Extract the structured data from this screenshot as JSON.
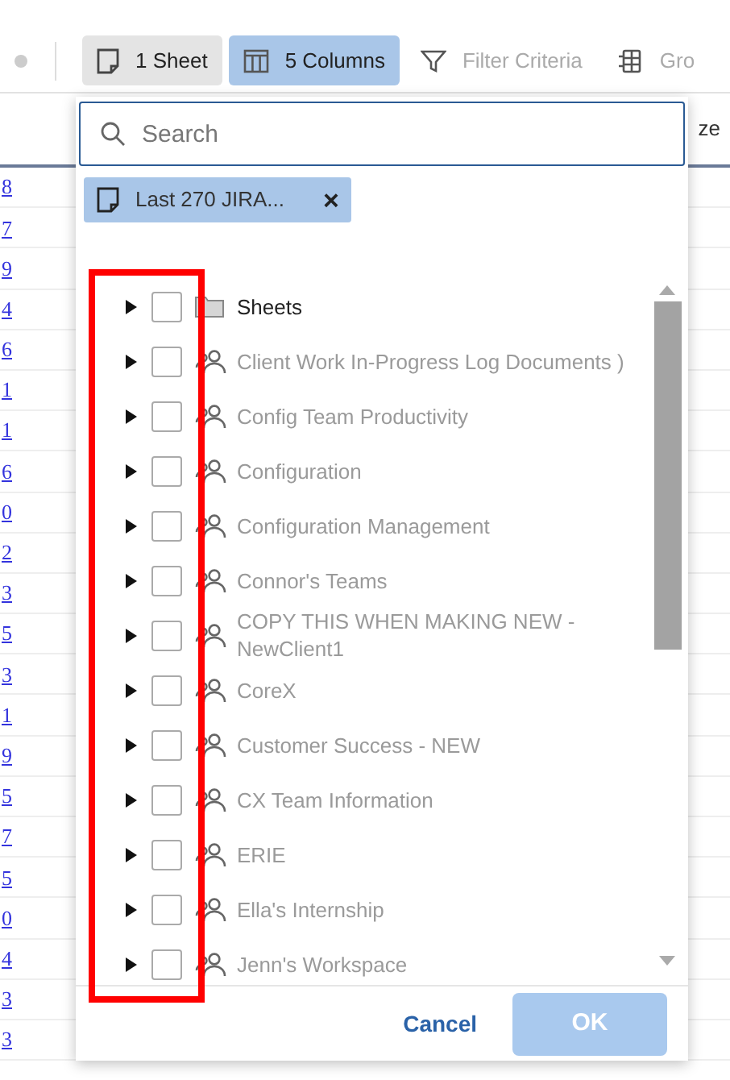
{
  "toolbar": {
    "buttons": [
      {
        "kind": "sheet",
        "label": "1 Sheet",
        "selected": false
      },
      {
        "kind": "columns",
        "label": "5 Columns",
        "selected": true
      },
      {
        "kind": "filter",
        "label": "Filter Criteria",
        "selected": false
      },
      {
        "kind": "group",
        "label": "Gro",
        "selected": false
      }
    ]
  },
  "table": {
    "header": {
      "column_2": "ze"
    },
    "rows": [
      "8",
      "7",
      "9",
      "4",
      "6",
      "1",
      "1",
      "6",
      "0",
      "2",
      "3",
      "5",
      "3",
      "1",
      "9",
      "5",
      "7",
      "5",
      "0",
      "4",
      "3",
      "3"
    ]
  },
  "popup": {
    "search": {
      "placeholder": "Search"
    },
    "chips": [
      {
        "label": "Last 270 JIRA...",
        "remove": "×"
      }
    ],
    "tree": [
      {
        "kind": "folder",
        "label": "Sheets",
        "checked": false,
        "expanded": false
      },
      {
        "kind": "workspace",
        "label": "Client Work In-Progress Log Documents )",
        "checked": false,
        "expanded": false
      },
      {
        "kind": "workspace",
        "label": "Config Team Productivity",
        "checked": false,
        "expanded": false
      },
      {
        "kind": "workspace",
        "label": "Configuration",
        "checked": false,
        "expanded": false
      },
      {
        "kind": "workspace",
        "label": "Configuration Management",
        "checked": false,
        "expanded": false
      },
      {
        "kind": "workspace",
        "label": "Connor's Teams",
        "checked": false,
        "expanded": false
      },
      {
        "kind": "workspace",
        "label": "COPY THIS WHEN MAKING NEW - NewClient1",
        "checked": false,
        "expanded": false
      },
      {
        "kind": "workspace",
        "label": "CoreX",
        "checked": false,
        "expanded": false
      },
      {
        "kind": "workspace",
        "label": "Customer Success - NEW",
        "checked": false,
        "expanded": false
      },
      {
        "kind": "workspace",
        "label": "CX Team Information",
        "checked": false,
        "expanded": false
      },
      {
        "kind": "workspace",
        "label": "ERIE",
        "checked": false,
        "expanded": false
      },
      {
        "kind": "workspace",
        "label": "Ella's Internship",
        "checked": false,
        "expanded": false
      },
      {
        "kind": "workspace",
        "label": "Jenn's Workspace",
        "checked": false,
        "expanded": false
      }
    ],
    "buttons": [
      {
        "kind": "cancel",
        "label": "Cancel",
        "disabled": false
      },
      {
        "kind": "ok",
        "label": "OK",
        "disabled": true
      }
    ]
  }
}
